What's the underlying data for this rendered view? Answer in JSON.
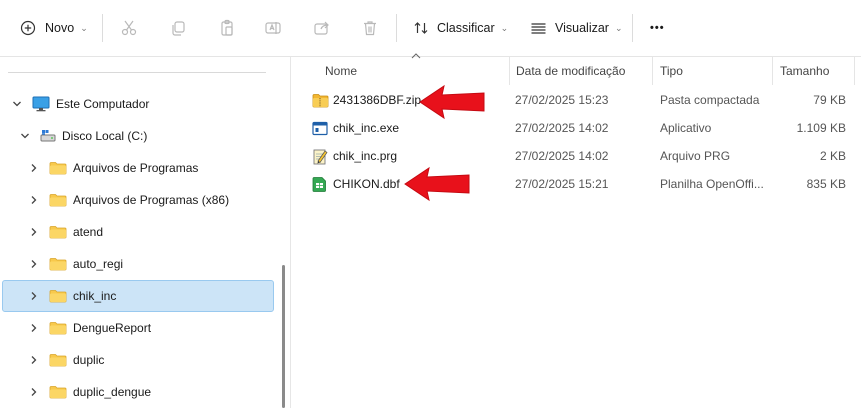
{
  "toolbar": {
    "new_label": "Novo",
    "sort_label": "Classificar",
    "view_label": "Visualizar",
    "more_label": "•••"
  },
  "sidebar": {
    "computer": "Este Computador",
    "drive": "Disco Local (C:)",
    "folders": [
      "Arquivos de Programas",
      "Arquivos de Programas (x86)",
      "atend",
      "auto_regi",
      "chik_inc",
      "DengueReport",
      "duplic",
      "duplic_dengue"
    ],
    "selected_folder": "chik_inc"
  },
  "columns": {
    "name": "Nome",
    "modified": "Data de modificação",
    "type": "Tipo",
    "size": "Tamanho"
  },
  "files": [
    {
      "name": "2431386DBF.zip",
      "modified": "27/02/2025 15:23",
      "type": "Pasta compactada",
      "size": "79 KB",
      "icon": "zip-folder-icon"
    },
    {
      "name": "chik_inc.exe",
      "modified": "27/02/2025 14:02",
      "type": "Aplicativo",
      "size": "1.109 KB",
      "icon": "exe-icon"
    },
    {
      "name": "chik_inc.prg",
      "modified": "27/02/2025 14:02",
      "type": "Arquivo PRG",
      "size": "2 KB",
      "icon": "prg-file-icon"
    },
    {
      "name": "CHIKON.dbf",
      "modified": "27/02/2025 15:21",
      "type": "Planilha OpenOffi...",
      "size": "835 KB",
      "icon": "spreadsheet-icon"
    }
  ],
  "colors": {
    "selection_bg": "#cce4f7",
    "selection_border": "#99c9ef",
    "folder_yellow": "#f8c94c",
    "annotation_red": "#e8111b"
  }
}
